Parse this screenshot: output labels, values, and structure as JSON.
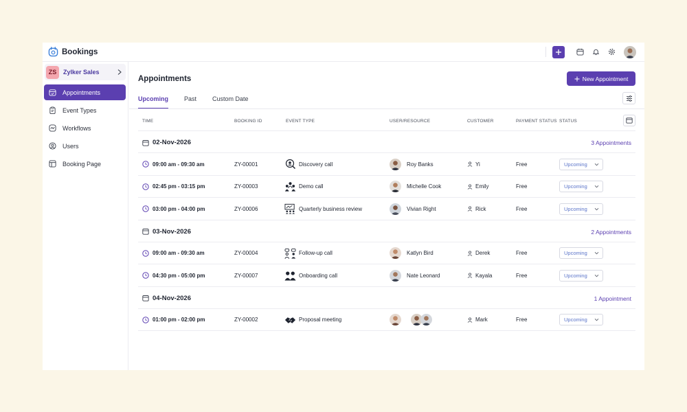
{
  "app": {
    "title": "Bookings"
  },
  "org": {
    "badge": "ZS",
    "name": "Zylker Sales"
  },
  "nav": [
    {
      "label": "Appointments",
      "icon": "calendar-check-icon",
      "active": true
    },
    {
      "label": "Event Types",
      "icon": "clipboard-icon",
      "active": false
    },
    {
      "label": "Workflows",
      "icon": "workflow-icon",
      "active": false
    },
    {
      "label": "Users",
      "icon": "user-circle-icon",
      "active": false
    },
    {
      "label": "Booking Page",
      "icon": "layout-icon",
      "active": false
    }
  ],
  "page": {
    "title": "Appointments",
    "new_button": "New Appointment",
    "tabs": [
      {
        "label": "Upcoming",
        "active": true
      },
      {
        "label": "Past",
        "active": false
      },
      {
        "label": "Custom Date",
        "active": false
      }
    ]
  },
  "table": {
    "headers": {
      "time": "TIME",
      "booking_id": "BOOKING ID",
      "event_type": "EVENT TYPE",
      "user_resource": "USER/RESOURCE",
      "customer": "CUSTOMER",
      "payment_status": "PAYMENT STATUS",
      "status": "STATUS"
    },
    "groups": [
      {
        "date": "02-Nov-2026",
        "count": "3 Appointments",
        "rows": [
          {
            "time": "09:00 am - 09:30 am",
            "id": "ZY-00001",
            "event": "Discovery call",
            "event_icon": "discovery-icon",
            "user": "Roy Banks",
            "customer": "Yi",
            "payment": "Free",
            "status": "Upcoming"
          },
          {
            "time": "02:45 pm - 03:15 pm",
            "id": "ZY-00003",
            "event": "Demo call",
            "event_icon": "group-icon",
            "user": "Michelle Cook",
            "customer": "Emily",
            "payment": "Free",
            "status": "Upcoming"
          },
          {
            "time": "03:00 pm - 04:00 pm",
            "id": "ZY-00006",
            "event": "Quarterly business review",
            "event_icon": "presentation-icon",
            "user": "Vivian Right",
            "customer": "Rick",
            "payment": "Free",
            "status": "Upcoming"
          }
        ]
      },
      {
        "date": "03-Nov-2026",
        "count": "2 Appointments",
        "rows": [
          {
            "time": "09:00 am - 09:30 am",
            "id": "ZY-00004",
            "event": "Follow-up call",
            "event_icon": "chat-people-icon",
            "user": "Katlyn Bird",
            "customer": "Derek",
            "payment": "Free",
            "status": "Upcoming"
          },
          {
            "time": "04:30 pm - 05:00 pm",
            "id": "ZY-00007",
            "event": "Onboarding call",
            "event_icon": "people-pair-icon",
            "user": "Nate Leonard",
            "customer": "Kayala",
            "payment": "Free",
            "status": "Upcoming"
          }
        ]
      },
      {
        "date": "04-Nov-2026",
        "count": "1 Appointment",
        "rows": [
          {
            "time": "01:00 pm - 02:00 pm",
            "id": "ZY-00002",
            "event": "Proposal meeting",
            "event_icon": "handshake-icon",
            "user": "",
            "customer": "Mark",
            "payment": "Free",
            "status": "Upcoming"
          }
        ]
      }
    ]
  },
  "colors": {
    "accent": "#5b3fb0",
    "link": "#5b74c9",
    "page_bg": "#fbf6e7"
  }
}
